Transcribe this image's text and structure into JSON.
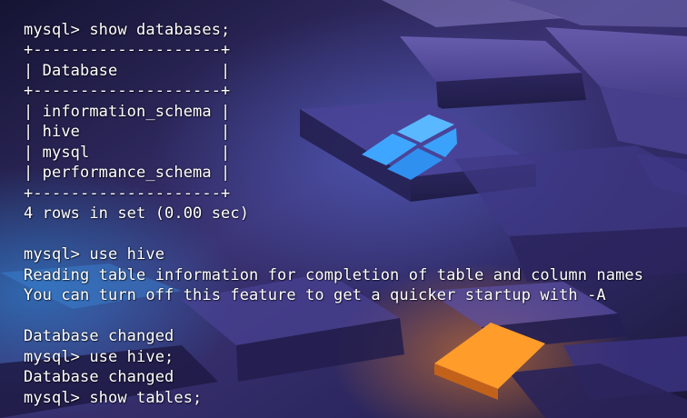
{
  "desktop": {
    "wallpaper": "windows-11-3d-blocks-wallpaper",
    "logo_icon": "windows-logo-icon",
    "colors": {
      "bg_dark": "#1c1a3f",
      "bg_purple": "#4a3f86",
      "accent_blue": "#3aa0ff",
      "accent_orange": "#ff9a1f",
      "text": "#ffffff"
    }
  },
  "terminal": {
    "lines": [
      "mysql> show databases;",
      "+--------------------+",
      "| Database           |",
      "+--------------------+",
      "| information_schema |",
      "| hive               |",
      "| mysql              |",
      "| performance_schema |",
      "+--------------------+",
      "4 rows in set (0.00 sec)",
      "",
      "mysql> use hive",
      "Reading table information for completion of table and column names",
      "You can turn off this feature to get a quicker startup with -A",
      "",
      "Database changed",
      "mysql> use hive;",
      "Database changed",
      "mysql> show tables;"
    ]
  }
}
